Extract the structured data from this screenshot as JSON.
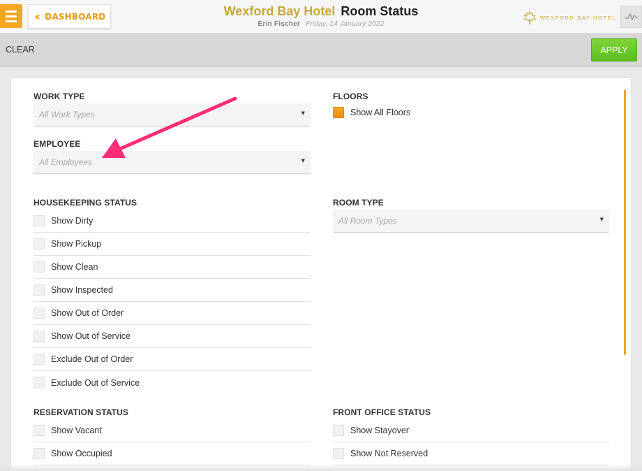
{
  "header": {
    "dashboard_label": "DASHBOARD",
    "hotel_name": "Wexford Bay Hotel",
    "page_title": "Room Status",
    "user_name": "Erin Fischer",
    "date": "Friday, 14 January 2022",
    "brand_text": "WEXFORD BAY HOTEL",
    "menu_icon": "hamburger-icon",
    "activity_icon": "activity-icon"
  },
  "toolbar": {
    "clear_label": "CLEAR",
    "apply_label": "APPLY"
  },
  "filters": {
    "work_type": {
      "label": "WORK TYPE",
      "placeholder": "All Work Types"
    },
    "employee": {
      "label": "EMPLOYEE",
      "placeholder": "All Employees"
    },
    "floors": {
      "label": "FLOORS",
      "option": "Show All Floors",
      "checked": true
    },
    "room_type": {
      "label": "ROOM TYPE",
      "placeholder": "All Room Types"
    },
    "housekeeping_status": {
      "label": "HOUSEKEEPING STATUS",
      "options": [
        "Show Dirty",
        "Show Pickup",
        "Show Clean",
        "Show Inspected",
        "Show Out of Order",
        "Show Out of Service",
        "Exclude Out of Order",
        "Exclude Out of Service"
      ]
    },
    "reservation_status": {
      "label": "RESERVATION STATUS",
      "options": [
        "Show Vacant",
        "Show Occupied"
      ]
    },
    "front_office_status": {
      "label": "FRONT OFFICE STATUS",
      "options": [
        "Show Stayover",
        "Show Not Reserved"
      ]
    }
  },
  "colors": {
    "accent": "#f5a623",
    "brand_gold": "#c7a83d",
    "apply_green": "#66c425",
    "annotation_arrow": "#ff2d78"
  }
}
